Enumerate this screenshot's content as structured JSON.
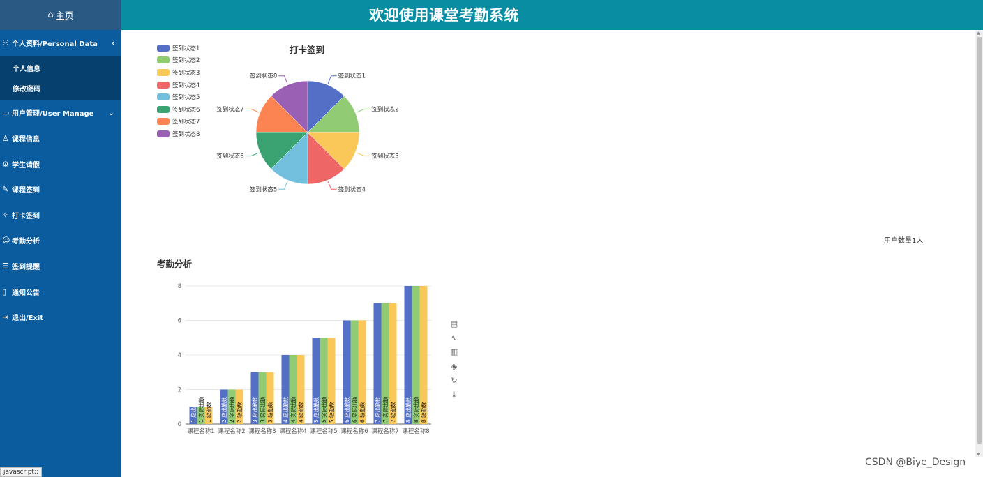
{
  "app": {
    "title": "欢迎使用课堂考勤系统"
  },
  "sidebar": {
    "home_label": "主页",
    "items": [
      {
        "label": "个人资料/Personal Data",
        "icon": "user-card-icon",
        "arrow": "‹",
        "expanded": true,
        "children": [
          {
            "label": "个人信息"
          },
          {
            "label": "修改密码"
          }
        ]
      },
      {
        "label": "用户管理/User Manage",
        "icon": "monitor-icon",
        "arrow": "⌄"
      },
      {
        "label": "课程信息",
        "icon": "person-icon"
      },
      {
        "label": "学生请假",
        "icon": "gear-icon"
      },
      {
        "label": "课程签到",
        "icon": "pencil-icon"
      },
      {
        "label": "打卡签到",
        "icon": "badge-icon"
      },
      {
        "label": "考勤分析",
        "icon": "smile-icon"
      },
      {
        "label": "签到提醒",
        "icon": "clipboard-icon"
      },
      {
        "label": "通知公告",
        "icon": "book-icon"
      },
      {
        "label": "退出/Exit",
        "icon": "exit-icon"
      }
    ]
  },
  "status_tip": "javascript:;",
  "main": {
    "pie": {
      "title": "打卡签到"
    },
    "user_count": "用户数量1人",
    "bar": {
      "title": "考勤分析"
    }
  },
  "toolbox": [
    "data-view-icon",
    "line-chart-icon",
    "bar-chart-icon",
    "stack-icon",
    "restore-icon",
    "download-icon"
  ],
  "watermark": "CSDN @Biye_Design",
  "colors": {
    "header": "#088da3",
    "sidebar": "#0a5c9e",
    "palette": [
      "#5470c6",
      "#91cc75",
      "#fac858",
      "#ee6666",
      "#73c0de",
      "#3ba272",
      "#fc8452",
      "#9a60b4"
    ]
  },
  "chart_data": [
    {
      "type": "pie",
      "title": "打卡签到",
      "legend_position": "top-left",
      "labels": [
        "签到状态1",
        "签到状态2",
        "签到状态3",
        "签到状态4",
        "签到状态5",
        "签到状态6",
        "签到状态7",
        "签到状态8"
      ],
      "values": [
        1,
        1,
        1,
        1,
        1,
        1,
        1,
        1
      ]
    },
    {
      "type": "bar",
      "title": "考勤分析",
      "categories": [
        "课程名称1",
        "课程名称2",
        "课程名称3",
        "课程名称4",
        "课程名称5",
        "课程名称6",
        "课程名称7",
        "课程名称8"
      ],
      "series": [
        {
          "name": "应出勤数",
          "values": [
            1,
            2,
            3,
            4,
            5,
            6,
            7,
            8
          ]
        },
        {
          "name": "实际出勤",
          "values": [
            1,
            2,
            3,
            4,
            5,
            6,
            7,
            8
          ]
        },
        {
          "name": "缺勤数",
          "values": [
            1,
            2,
            3,
            4,
            5,
            6,
            7,
            8
          ]
        }
      ],
      "ylim": [
        0,
        8
      ],
      "yticks": [
        0,
        2,
        4,
        6,
        8
      ],
      "grid": true
    }
  ]
}
